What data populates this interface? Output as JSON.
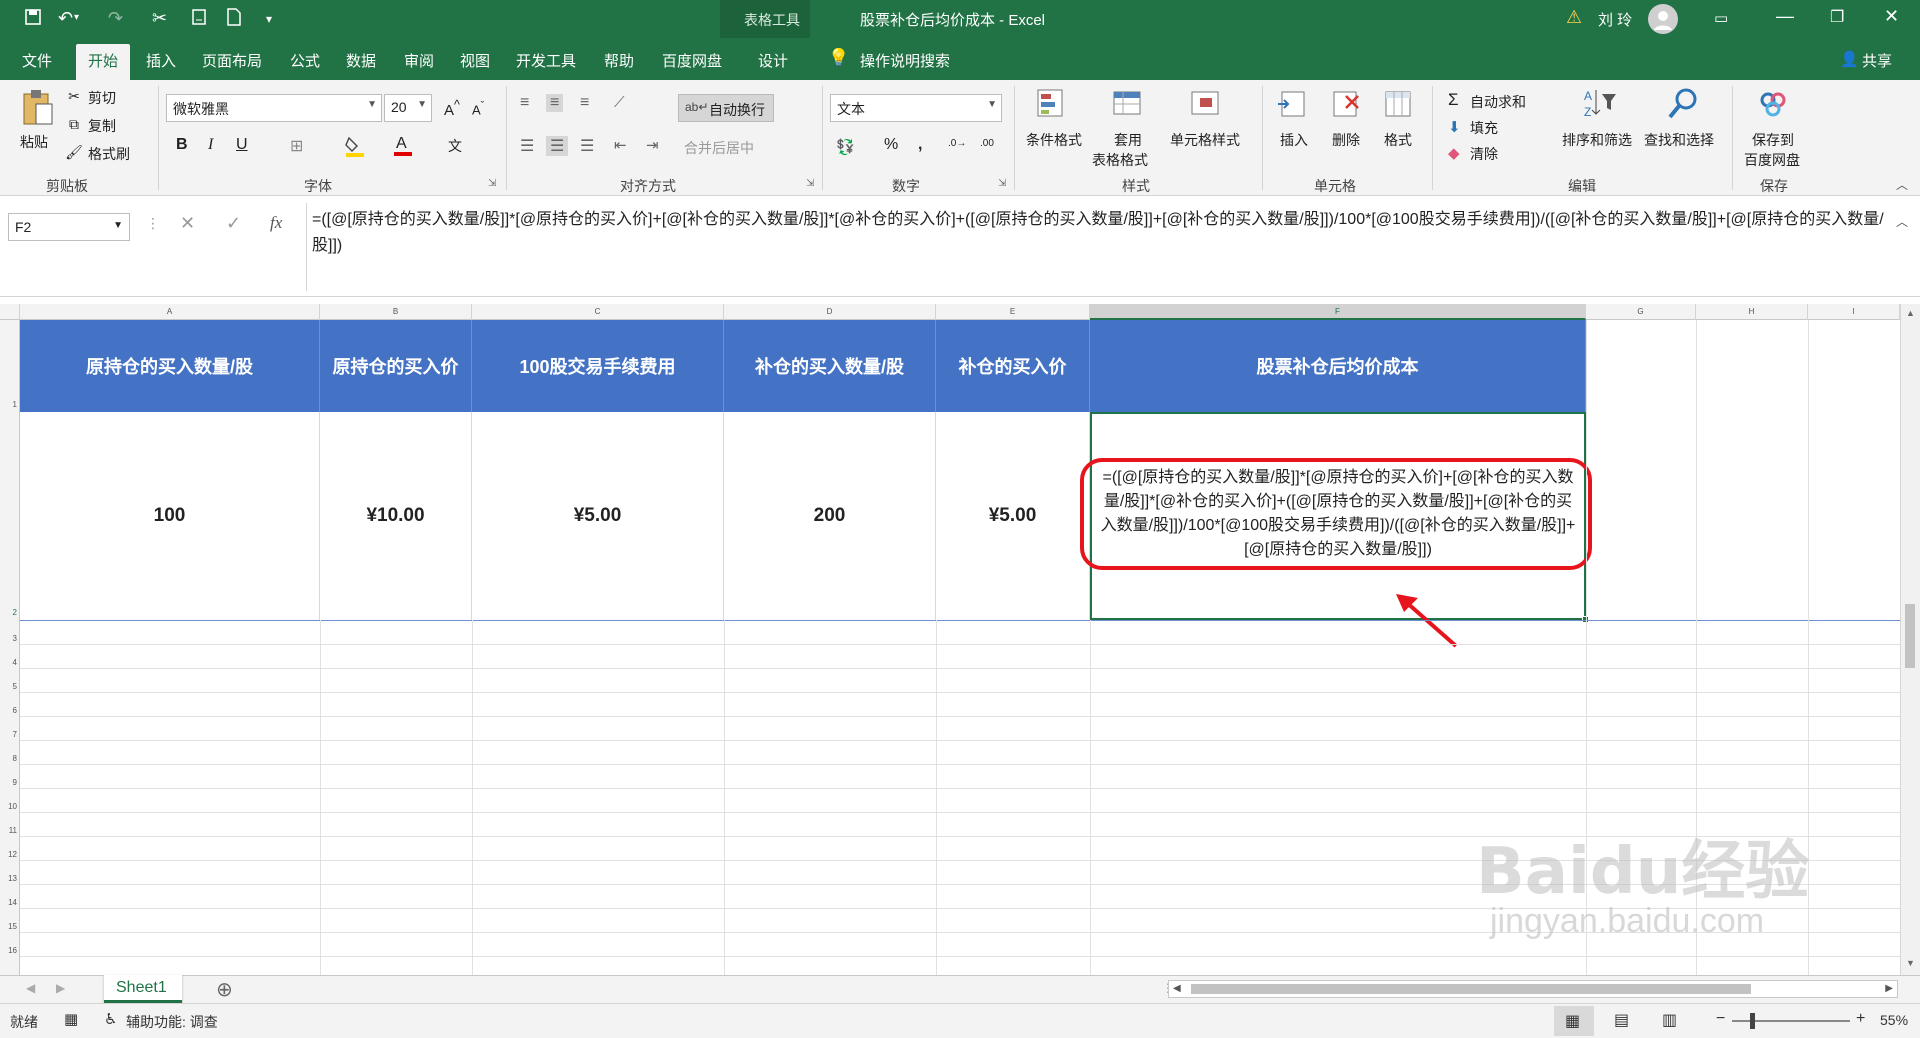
{
  "window": {
    "table_tools": "表格工具",
    "title": "股票补仓后均价成本 - Excel",
    "user": "刘 玲"
  },
  "tabs": [
    "文件",
    "开始",
    "插入",
    "页面布局",
    "公式",
    "数据",
    "审阅",
    "视图",
    "开发工具",
    "帮助",
    "百度网盘",
    "设计"
  ],
  "tell_me": "操作说明搜索",
  "share": "共享",
  "clipboard": {
    "paste": "粘贴",
    "cut": "剪切",
    "copy": "复制",
    "format_painter": "格式刷",
    "group": "剪贴板"
  },
  "font": {
    "name": "微软雅黑",
    "size": "20",
    "bold": "B",
    "italic": "I",
    "underline": "U",
    "group": "字体",
    "font_color": "#e00000",
    "fill_color": "#ffd400"
  },
  "alignment": {
    "wrap": "自动换行",
    "merge": "合并后居中",
    "group": "对齐方式"
  },
  "number": {
    "format": "文本",
    "group": "数字"
  },
  "styles": {
    "conditional": "条件格式",
    "table_fmt_1": "套用",
    "table_fmt_2": "表格格式",
    "cell_styles": "单元格样式",
    "group": "样式"
  },
  "cells": {
    "insert": "插入",
    "delete": "删除",
    "format": "格式",
    "group": "单元格"
  },
  "editing": {
    "autosum": "自动求和",
    "fill": "填充",
    "clear": "清除",
    "sort_filter": "排序和筛选",
    "find_select": "查找和选择",
    "group": "编辑"
  },
  "save_group": {
    "line1": "保存到",
    "line2": "百度网盘",
    "group": "保存"
  },
  "formula_bar": {
    "name_box": "F2",
    "fx": "fx",
    "formula": "=([@[原持仓的买入数量/股]]*[@原持仓的买入价]+[@[补仓的买入数量/股]]*[@补仓的买入价]+([@[原持仓的买入数量/股]]+[@[补仓的买入数量/股]])/100*[@100股交易手续费用])/([@[补仓的买入数量/股]]+[@[原持仓的买入数量/股]])"
  },
  "columns": [
    "A",
    "B",
    "C",
    "D",
    "E",
    "F",
    "G",
    "H",
    "I"
  ],
  "rows": [
    "1",
    "2",
    "3",
    "4",
    "5",
    "6",
    "7",
    "8",
    "9",
    "10",
    "11",
    "12",
    "13",
    "14",
    "15",
    "16"
  ],
  "table": {
    "headers": [
      "原持仓的买入数量/股",
      "原持仓的买入价",
      "100股交易手续费用",
      "补仓的买入数量/股",
      "补仓的买入价",
      "股票补仓后均价成本"
    ],
    "values": [
      "100",
      "¥10.00",
      "¥5.00",
      "200",
      "¥5.00",
      ""
    ],
    "header_color": "#4472c4",
    "f2_formula_display": "=([@[原持仓的买入数量/股]]*[@原持仓的买入价]+[@[补仓的买入数量/股]]*[@补仓的买入价]+([@[原持仓的买入数量/股]]+[@[补仓的买入数量/股]])/100*[@100股交易手续费用])/([@[补仓的买入数量/股]]+[@[原持仓的买入数量/股]])"
  },
  "sheet_tab": "Sheet1",
  "status": {
    "ready": "就绪",
    "accessibility": "辅助功能: 调查",
    "zoom": "55%"
  },
  "watermark": {
    "line1": "Baidu经验",
    "line2": "jingyan.baidu.com"
  },
  "accent": "#217346"
}
